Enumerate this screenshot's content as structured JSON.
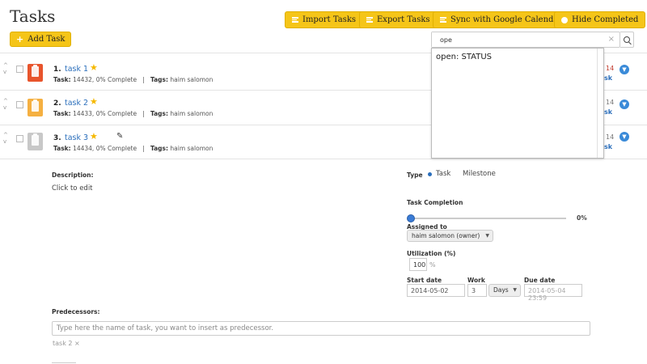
{
  "header": {
    "title": "Tasks",
    "add_task": "Add Task",
    "import_tasks": "Import Tasks",
    "export_tasks": "Export Tasks",
    "sync_google": "Sync with Google Calendar",
    "hide_completed": "Hide Completed"
  },
  "search": {
    "value": "ope",
    "clear": "×"
  },
  "dropdown": {
    "options": [
      "open: STATUS"
    ]
  },
  "tasks": [
    {
      "num": "1.",
      "name": "task 1",
      "task_label": "Task:",
      "task_meta": "14432, 0% Complete",
      "sep": "|",
      "tags_label": "Tags:",
      "tags": "haim salomon",
      "right_num": "14",
      "right_link": "sk"
    },
    {
      "num": "2.",
      "name": "task 2",
      "task_label": "Task:",
      "task_meta": "14433, 0% Complete",
      "sep": "|",
      "tags_label": "Tags:",
      "tags": "haim salomon",
      "right_num": "14",
      "right_link": "sk"
    },
    {
      "num": "3.",
      "name": "task 3",
      "task_label": "Task:",
      "task_meta": "14434, 0% Complete",
      "sep": "|",
      "tags_label": "Tags:",
      "tags": "haim salomon",
      "right_num": "14",
      "right_link": "sk"
    }
  ],
  "details": {
    "description_label": "Description:",
    "description_value": "Click to edit",
    "type_label": "Type",
    "type_task": "Task",
    "type_milestone": "Milestone",
    "completion_label": "Task Completion",
    "completion_value": "0%",
    "completion_fraction": 0,
    "assigned_label": "Assigned to",
    "assigned_value": "haim salomon (owner)",
    "utilization_label": "Utilization (%)",
    "utilization_value": "100",
    "utilization_unit": "%",
    "start_label": "Start date",
    "start_value": "2014-05-02",
    "work_label": "Work",
    "work_value": "3",
    "work_unit": "Days",
    "due_label": "Due date",
    "due_value": "2014-05-04 23:59",
    "predecessors_label": "Predecessors:",
    "predecessors_placeholder": "Type here the name of task, you want to insert as predecessor.",
    "predecessor_tag": "task 2 ×"
  },
  "colors": {
    "accent": "#f5c518",
    "link": "#2a6ebb",
    "task1_icon": "#e8542c",
    "task2_icon": "#f5b041",
    "task3_icon": "#c8c8c8"
  }
}
